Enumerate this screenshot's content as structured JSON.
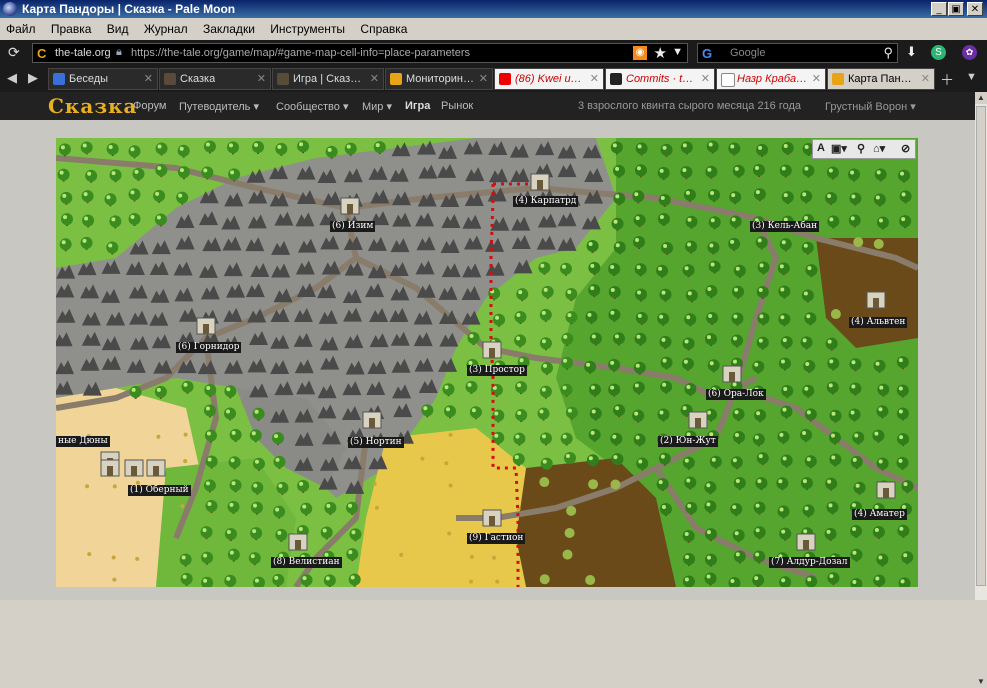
{
  "window": {
    "title": "Карта Пандоры | Сказка - Pale Moon",
    "controls": [
      "_",
      "▣",
      "✕"
    ]
  },
  "menu": [
    "Файл",
    "Правка",
    "Вид",
    "Журнал",
    "Закладки",
    "Инструменты",
    "Справка"
  ],
  "nav": {
    "domain": "the-tale.org",
    "url": "https://the-tale.org/game/map/#game-map-cell-info=place-parameters",
    "search_placeholder": "Google",
    "search_engine_icon": "G"
  },
  "tabs": [
    {
      "label": "Беседы",
      "icon": "chat-icon"
    },
    {
      "label": "Сказка",
      "icon": "page-icon"
    },
    {
      "label": "Игра | Сказ…",
      "icon": "page-icon"
    },
    {
      "label": "Мониторин…",
      "icon": "tale-icon"
    },
    {
      "label": "(86) Kwei и…",
      "icon": "youtube-icon"
    },
    {
      "label": "Commits · t…",
      "icon": "github-icon"
    },
    {
      "label": "Назр Краба…",
      "icon": "page-icon"
    },
    {
      "label": "Карта Пан…",
      "icon": "tale-icon",
      "active": true
    }
  ],
  "site": {
    "logo": "Сказка",
    "menu": [
      {
        "label": "Форум"
      },
      {
        "label": "Путеводитель ▾"
      },
      {
        "label": "Сообщество ▾"
      },
      {
        "label": "Мир ▾"
      },
      {
        "label": "Игра",
        "bold": true
      },
      {
        "label": "Рынок"
      }
    ],
    "date": "3 взрослого квинта сырого месяца 216 года",
    "user": "Грустный Ворон ▾"
  },
  "map": {
    "toolbar": [
      "A",
      "▣▾",
      "⚲",
      "⌂▾",
      "⊘"
    ],
    "cities": [
      {
        "label": "(4) Карпатрд"
      },
      {
        "label": "(6) Изим"
      },
      {
        "label": "(3) Кель-Абан"
      },
      {
        "label": "(4) Альвтен"
      },
      {
        "label": "(6) Горнидор"
      },
      {
        "label": "(3) Простор"
      },
      {
        "label": "(6) Ора-Лок"
      },
      {
        "label": "ные Дюны"
      },
      {
        "label": "(5) Нортин"
      },
      {
        "label": "(2) Юн-Жут"
      },
      {
        "label": "(1) Оберный"
      },
      {
        "label": "(4) Аматер"
      },
      {
        "label": "(9) Гастион"
      },
      {
        "label": "(8) Велистиан"
      },
      {
        "label": "(7) Алдур-Дозал"
      }
    ],
    "colors": {
      "grass": "#7bc043",
      "dark_grass": "#4a9a2a",
      "forest": "#3f8a22",
      "mountain": "#8a8a8a",
      "road": "#8c8070",
      "desert": "#e8c84a",
      "sand": "#f2d8a0",
      "swamp": "#6b4a1a",
      "route": "#d01010"
    }
  }
}
